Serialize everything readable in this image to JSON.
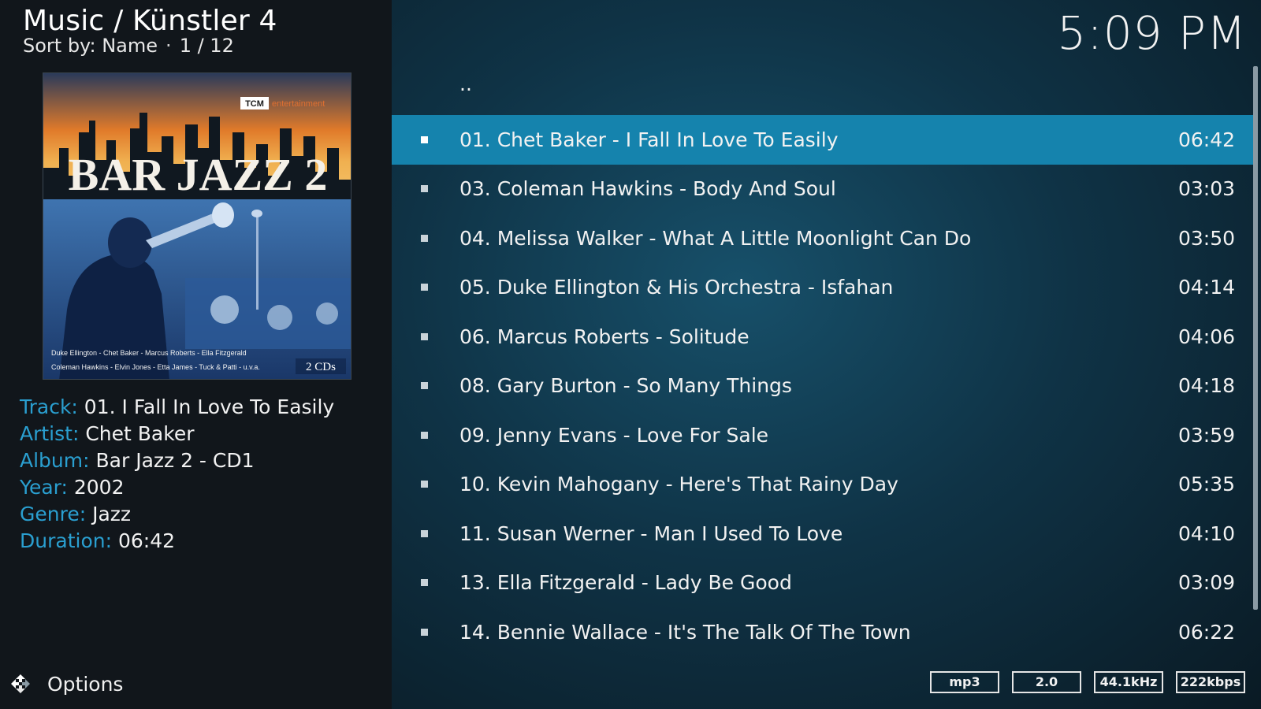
{
  "header": {
    "title": "Music / Künstler 4",
    "sort_label": "Sort by: Name",
    "position": "1 / 12",
    "clock": "5:09 PM"
  },
  "album_cover": {
    "label_brand": "TCM",
    "label_sub": "entertainment",
    "title": "BAR JAZZ 2",
    "artists_line1": "Duke Ellington - Chet Baker - Marcus Roberts - Ella Fitzgerald",
    "artists_line2": "Coleman Hawkins - Elvin Jones - Etta James - Tuck & Patti - u.v.a.",
    "discs": "2 CDs"
  },
  "info": [
    {
      "key": "Track:",
      "value": "01. I Fall In Love To Easily"
    },
    {
      "key": "Artist:",
      "value": "Chet Baker"
    },
    {
      "key": "Album:",
      "value": "Bar Jazz 2 - CD1"
    },
    {
      "key": "Year:",
      "value": "2002"
    },
    {
      "key": "Genre:",
      "value": "Jazz"
    },
    {
      "key": "Duration:",
      "value": "06:42"
    }
  ],
  "options_label": "Options",
  "list": {
    "parent": "..",
    "items": [
      {
        "title": "01. Chet Baker - I Fall In Love To Easily",
        "duration": "06:42",
        "selected": true
      },
      {
        "title": "03. Coleman Hawkins - Body And Soul",
        "duration": "03:03"
      },
      {
        "title": "04. Melissa Walker - What A Little Moonlight Can Do",
        "duration": "03:50"
      },
      {
        "title": "05. Duke Ellington & His Orchestra - Isfahan",
        "duration": "04:14"
      },
      {
        "title": "06. Marcus Roberts - Solitude",
        "duration": "04:06"
      },
      {
        "title": "08. Gary Burton - So Many Things",
        "duration": "04:18"
      },
      {
        "title": "09. Jenny Evans - Love For Sale",
        "duration": "03:59"
      },
      {
        "title": "10. Kevin Mahogany - Here's That Rainy Day",
        "duration": "05:35"
      },
      {
        "title": "11. Susan Werner - Man I Used To Love",
        "duration": "04:10"
      },
      {
        "title": "13. Ella Fitzgerald - Lady Be Good",
        "duration": "03:09"
      },
      {
        "title": "14. Bennie Wallace - It's The Talk Of The Town",
        "duration": "06:22"
      }
    ]
  },
  "badges": [
    "mp3",
    "2.0",
    "44.1kHz",
    "222kbps"
  ],
  "colors": {
    "accent": "#2a9fd0",
    "selected_row": "#1583ad"
  }
}
